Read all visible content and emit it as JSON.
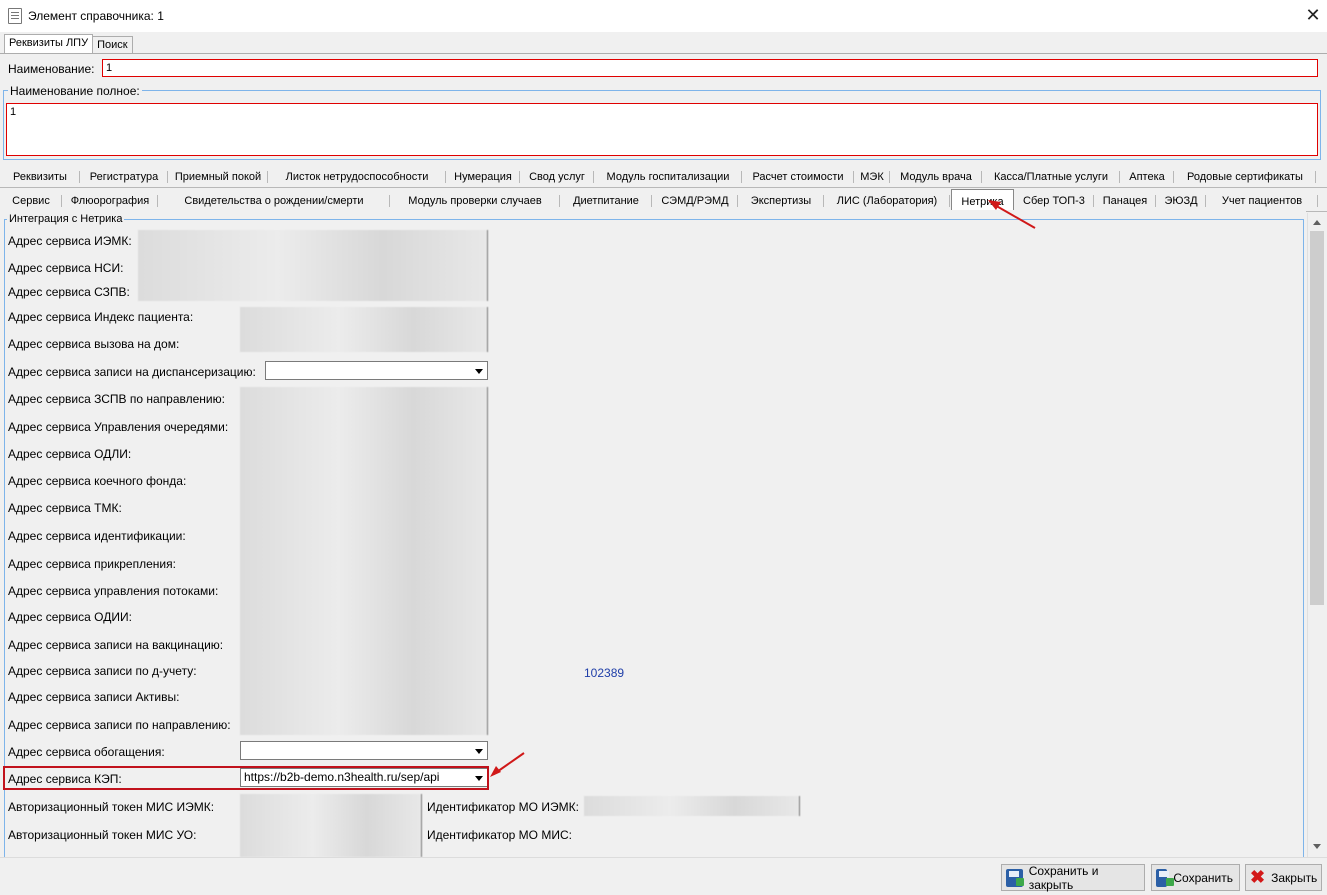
{
  "window": {
    "title": "Элемент справочника: 1",
    "icon": "document-icon",
    "close_glyph": "✕"
  },
  "top_tabs": [
    {
      "label": "Реквизиты ЛПУ",
      "active": true
    },
    {
      "label": "Поиск",
      "active": false
    }
  ],
  "name_field": {
    "label": "Наименование:",
    "value": "1"
  },
  "fullname_field": {
    "label": "Наименование полное:",
    "value": "1"
  },
  "tabs_row1": [
    "Реквизиты",
    "Регистратура",
    "Приемный покой",
    "Листок нетрудоспособности",
    "Нумерация",
    "Свод услуг",
    "Модуль госпитализации",
    "Расчет стоимости",
    "МЭК",
    "Модуль врача",
    "Касса/Платные услуги",
    "Аптека",
    "Родовые сертификаты"
  ],
  "tabs_row2": [
    "Сервис",
    "Флюорография",
    "Свидетельства о рождении/смерти",
    "Модуль проверки случаев",
    "Диетпитание",
    "СЭМД/РЭМД",
    "Экспертизы",
    "ЛИС (Лаборатория)",
    "Нетрика",
    "Сбер ТОП-3",
    "Панацея",
    "ЭЮЗД",
    "Учет пациентов"
  ],
  "active_tab": "Нетрика",
  "group_title": "Интеграция с Нетрика",
  "fields": [
    {
      "label": "Адрес сервиса ИЭМК:"
    },
    {
      "label": "Адрес сервиса НСИ:"
    },
    {
      "label": "Адрес сервиса СЗПВ:"
    },
    {
      "label": "Адрес сервиса Индекс пациента:"
    },
    {
      "label": "Адрес сервиса вызова на дом:"
    },
    {
      "label": "Адрес сервиса записи на диспансеризацию:"
    },
    {
      "label": "Адрес сервиса ЗСПВ по направлению:"
    },
    {
      "label": "Адрес сервиса Управления очередями:"
    },
    {
      "label": "Адрес сервиса ОДЛИ:"
    },
    {
      "label": "Адрес сервиса коечного фонда:"
    },
    {
      "label": "Адрес сервиса ТМК:"
    },
    {
      "label": "Адрес сервиса идентификации:"
    },
    {
      "label": "Адрес сервиса прикрепления:"
    },
    {
      "label": "Адрес сервиса управления потоками:"
    },
    {
      "label": "Адрес сервиса ОДИИ:"
    },
    {
      "label": "Адрес сервиса записи на вакцинацию:"
    },
    {
      "label": "Адрес сервиса записи по д-учету:"
    },
    {
      "label": "Адрес сервиса записи Активы:"
    },
    {
      "label": "Адрес сервиса записи по направлению:"
    },
    {
      "label": "Адрес сервиса обогащения:"
    },
    {
      "label": "Адрес сервиса КЭП:",
      "value": "https://b2b-demo.n3health.ru/sep/api"
    },
    {
      "label": "Авторизационный токен МИС ИЭМК:"
    },
    {
      "label": "Авторизационный токен МИС УО:"
    }
  ],
  "right_fields": [
    {
      "label": "Идентификатор МО ИЭМК:"
    },
    {
      "label": "Идентификатор МО МИС:"
    }
  ],
  "side_number": "102389",
  "buttons": {
    "save_close": "Сохранить и закрыть",
    "save": "Сохранить",
    "close": "Закрыть"
  },
  "colors": {
    "highlight": "#c1121c",
    "group_border": "#7eb4ea",
    "link": "#1f3ea8"
  }
}
